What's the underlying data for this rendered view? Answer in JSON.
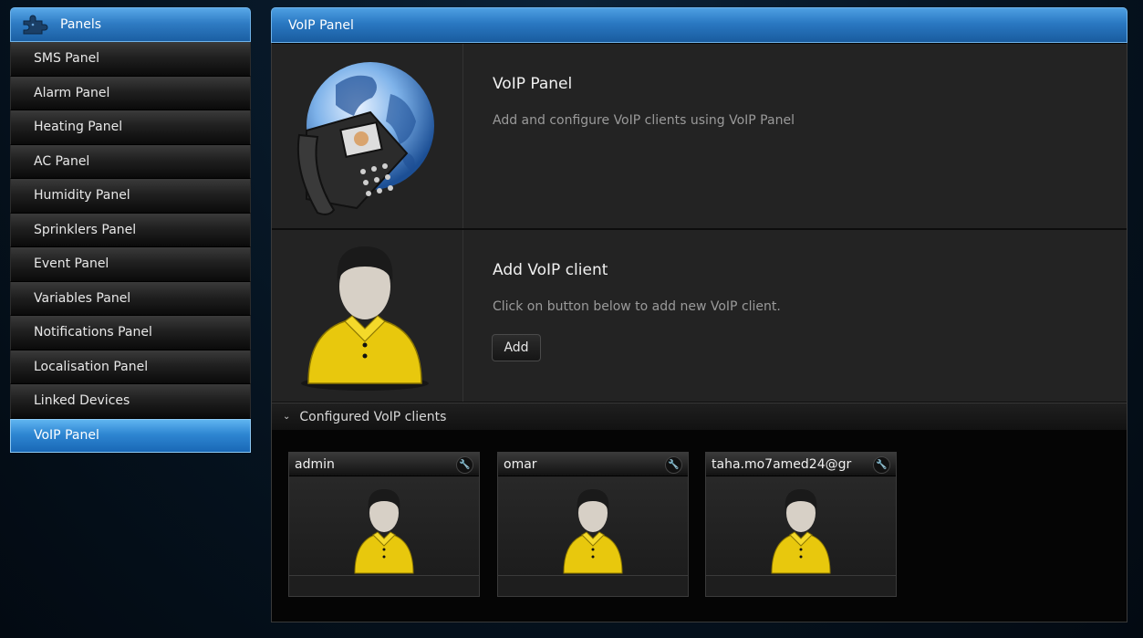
{
  "sidebar": {
    "header": "Panels",
    "icon": "puzzle-icon",
    "items": [
      {
        "label": "SMS Panel",
        "active": false
      },
      {
        "label": "Alarm Panel",
        "active": false
      },
      {
        "label": "Heating Panel",
        "active": false
      },
      {
        "label": "AC Panel",
        "active": false
      },
      {
        "label": "Humidity Panel",
        "active": false
      },
      {
        "label": "Sprinklers Panel",
        "active": false
      },
      {
        "label": "Event Panel",
        "active": false
      },
      {
        "label": "Variables Panel",
        "active": false
      },
      {
        "label": "Notifications Panel",
        "active": false
      },
      {
        "label": "Localisation Panel",
        "active": false
      },
      {
        "label": "Linked Devices",
        "active": false
      },
      {
        "label": "VoIP Panel",
        "active": true
      }
    ]
  },
  "main": {
    "header": "VoIP Panel",
    "intro": {
      "icon": "voip-phone-globe-icon",
      "title": "VoIP Panel",
      "description": "Add and configure VoIP clients using VoIP Panel"
    },
    "add_client": {
      "icon": "user-avatar-icon",
      "title": "Add VoIP client",
      "description": "Click on button below to add new VoIP client.",
      "button": "Add"
    },
    "clients_section": {
      "title": "Configured VoIP clients",
      "clients": [
        {
          "name": "admin",
          "icon": "user-avatar-icon"
        },
        {
          "name": "omar",
          "icon": "user-avatar-icon"
        },
        {
          "name": "taha.mo7amed24@gr",
          "icon": "user-avatar-icon"
        }
      ]
    }
  },
  "colors": {
    "accent_blue": "#2e86d2",
    "shirt_yellow": "#f2d20c"
  }
}
